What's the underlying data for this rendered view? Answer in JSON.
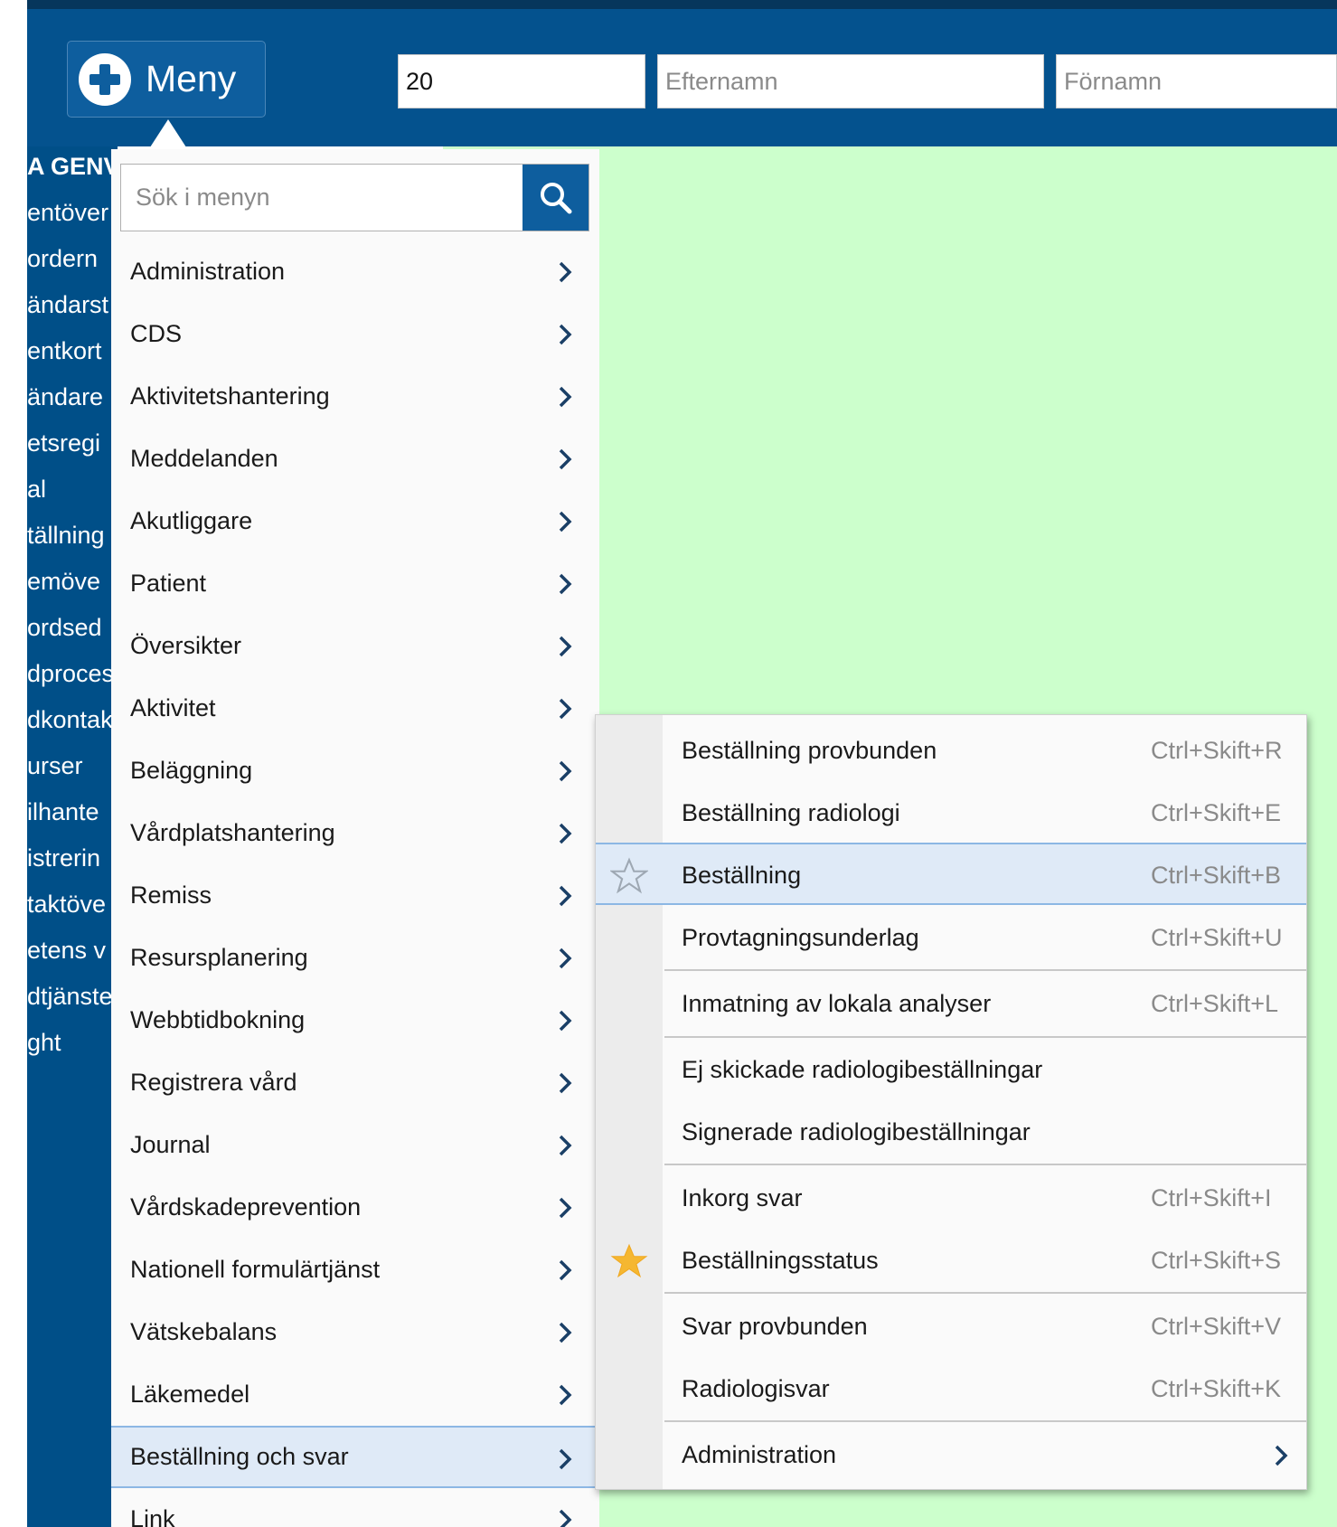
{
  "header": {
    "menu_label": "Meny",
    "pnr_value": "20",
    "efternamn_placeholder": "Efternamn",
    "fornamn_placeholder": "Förnamn"
  },
  "leftnav": {
    "items": [
      "A GENV",
      "entöver",
      "ordern",
      "ändarst",
      "entkort",
      "ändare",
      "etsregi",
      "al",
      "tällning",
      "emöve",
      "ordsed",
      "dproces",
      "dkontak",
      "urser",
      "ilhante",
      "istrerin",
      "taktöve",
      "etens v",
      "dtjänste",
      "ght"
    ]
  },
  "menu": {
    "search_placeholder": "Sök i menyn",
    "items": [
      "Administration",
      "CDS",
      "Aktivitetshantering",
      "Meddelanden",
      "Akutliggare",
      "Patient",
      "Översikter",
      "Aktivitet",
      "Beläggning",
      "Vårdplatshantering",
      "Remiss",
      "Resursplanering",
      "Webbtidbokning",
      "Registrera vård",
      "Journal",
      "Vårdskadeprevention",
      "Nationell formulärtjänst",
      "Vätskebalans",
      "Läkemedel",
      "Beställning och svar",
      "Link"
    ],
    "selected": "Beställning och svar"
  },
  "submenu": {
    "items": [
      {
        "label": "Beställning provbunden",
        "shortcut": "Ctrl+Skift+R"
      },
      {
        "label": "Beställning radiologi",
        "shortcut": "Ctrl+Skift+E"
      },
      {
        "label": "Beställning",
        "shortcut": "Ctrl+Skift+B",
        "star": "empty",
        "selected": true
      },
      {
        "label": "Provtagningsunderlag",
        "shortcut": "Ctrl+Skift+U"
      },
      {
        "label": "Inmatning av lokala analyser",
        "shortcut": "Ctrl+Skift+L"
      },
      {
        "label": "Ej skickade radiologibeställningar",
        "shortcut": ""
      },
      {
        "label": "Signerade radiologibeställningar",
        "shortcut": ""
      },
      {
        "label": "Inkorg svar",
        "shortcut": "Ctrl+Skift+I"
      },
      {
        "label": "Beställningsstatus",
        "shortcut": "Ctrl+Skift+S",
        "star": "filled"
      },
      {
        "label": "Svar provbunden",
        "shortcut": "Ctrl+Skift+V"
      },
      {
        "label": "Radiologisvar",
        "shortcut": "Ctrl+Skift+K"
      },
      {
        "label": "Administration",
        "shortcut": "",
        "submenu": true
      }
    ]
  },
  "colors": {
    "header_bg": "#04528e",
    "content_bg": "#ccffcc",
    "selection_bg": "#dfeaf7",
    "star_filled": "#f5b731"
  }
}
